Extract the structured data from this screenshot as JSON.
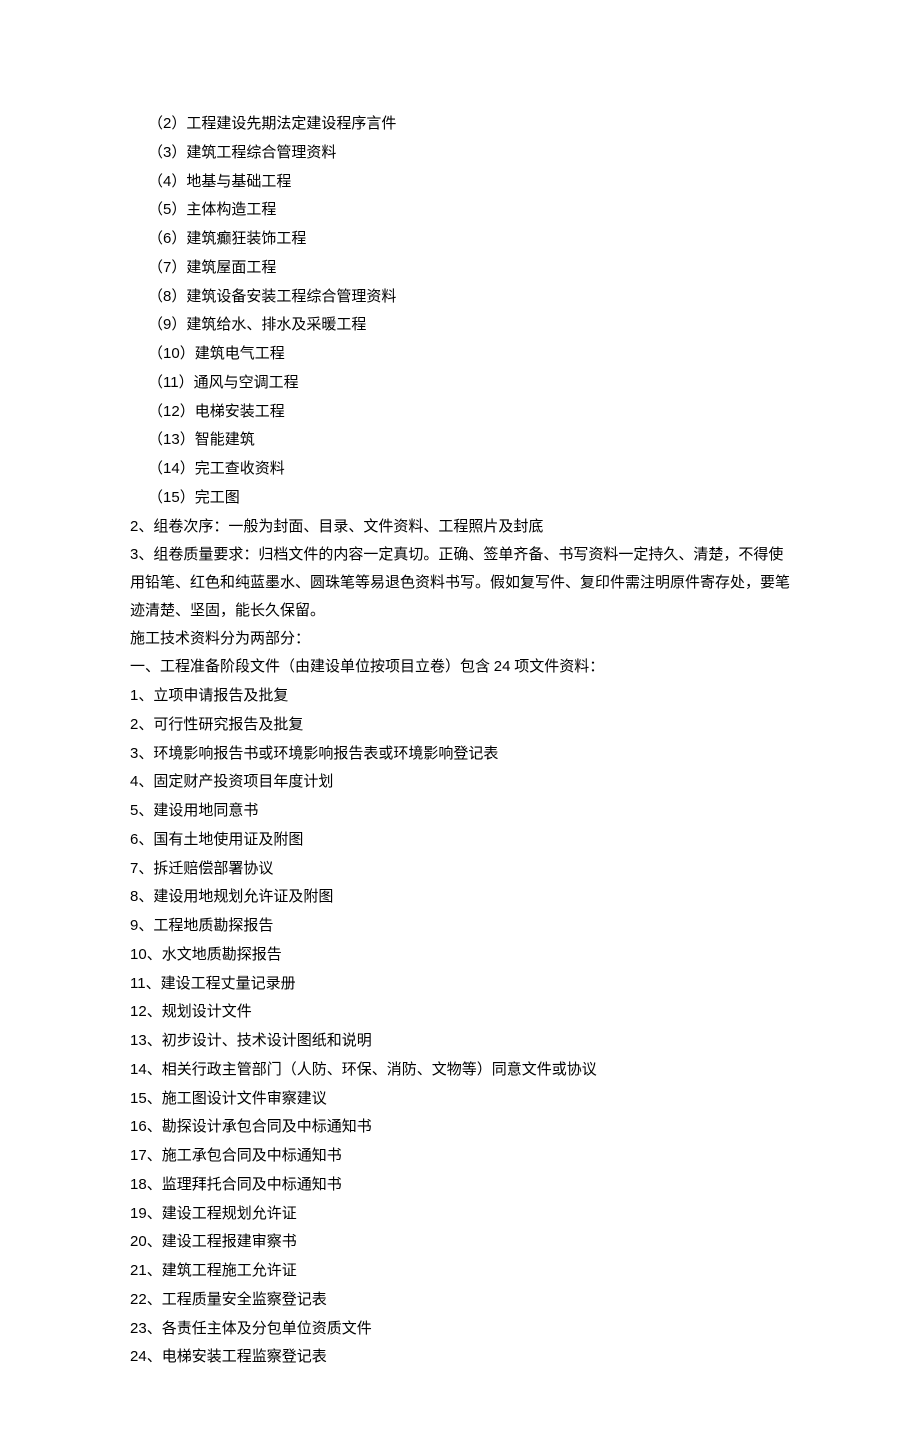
{
  "group1": {
    "items": [
      {
        "num": "2",
        "text": "工程建设先期法定建设程序言件"
      },
      {
        "num": "3",
        "text": "建筑工程综合管理资料"
      },
      {
        "num": "4",
        "text": "地基与基础工程"
      },
      {
        "num": "5",
        "text": "主体构造工程"
      },
      {
        "num": "6",
        "text": "建筑癫狂装饰工程"
      },
      {
        "num": "7",
        "text": "建筑屋面工程"
      },
      {
        "num": "8",
        "text": "建筑设备安装工程综合管理资料"
      },
      {
        "num": "9",
        "text": "建筑给水、排水及采暖工程"
      },
      {
        "num": "10",
        "text": "建筑电气工程"
      },
      {
        "num": "11",
        "text": "通风与空调工程"
      },
      {
        "num": "12",
        "text": "电梯安装工程"
      },
      {
        "num": "13",
        "text": "智能建筑"
      },
      {
        "num": "14",
        "text": "完工查收资料"
      },
      {
        "num": "15",
        "text": "完工图"
      }
    ]
  },
  "paragraphs": {
    "p2": "2、组卷次序：一般为封面、目录、文件资料、工程照片及封底",
    "p3": "3、组卷质量要求：归档文件的内容一定真切。正确、签单齐备、书写资料一定持久、清楚，不得使用铅笔、红色和纯蓝墨水、圆珠笔等易退色资料书写。假如复写件、复印件需注明原件寄存处，要笔迹清楚、坚固，能长久保留。",
    "p4": "施工技术资料分为两部分：",
    "p5_pre": "一、工程准备阶段文件（由建设单位按项目立卷）包含 ",
    "p5_num": "24",
    "p5_post": " 项文件资料："
  },
  "list2": {
    "items": [
      {
        "num": "1",
        "text": "立项申请报告及批复"
      },
      {
        "num": "2",
        "text": "可行性研究报告及批复"
      },
      {
        "num": "3",
        "text": "环境影响报告书或环境影响报告表或环境影响登记表"
      },
      {
        "num": "4",
        "text": "固定财产投资项目年度计划"
      },
      {
        "num": "5",
        "text": "建设用地同意书"
      },
      {
        "num": "6",
        "text": "国有土地使用证及附图"
      },
      {
        "num": "7",
        "text": "拆迁赔偿部署协议"
      },
      {
        "num": "8",
        "text": "建设用地规划允许证及附图"
      },
      {
        "num": "9",
        "text": "工程地质勘探报告"
      },
      {
        "num": "10",
        "text": "水文地质勘探报告"
      },
      {
        "num": "11",
        "text": "建设工程丈量记录册"
      },
      {
        "num": "12",
        "text": "规划设计文件"
      },
      {
        "num": "13",
        "text": "初步设计、技术设计图纸和说明"
      },
      {
        "num": "14",
        "text": "相关行政主管部门（人防、环保、消防、文物等）同意文件或协议"
      },
      {
        "num": "15",
        "text": "施工图设计文件审察建议"
      },
      {
        "num": "16",
        "text": "勘探设计承包合同及中标通知书"
      },
      {
        "num": "17",
        "text": "施工承包合同及中标通知书"
      },
      {
        "num": "18",
        "text": "监理拜托合同及中标通知书"
      },
      {
        "num": "19",
        "text": "建设工程规划允许证"
      },
      {
        "num": "20",
        "text": "建设工程报建审察书"
      },
      {
        "num": "21",
        "text": "建筑工程施工允许证"
      },
      {
        "num": "22",
        "text": "工程质量安全监察登记表"
      },
      {
        "num": "23",
        "text": "各责任主体及分包单位资质文件"
      },
      {
        "num": "24",
        "text": "电梯安装工程监察登记表"
      }
    ]
  }
}
